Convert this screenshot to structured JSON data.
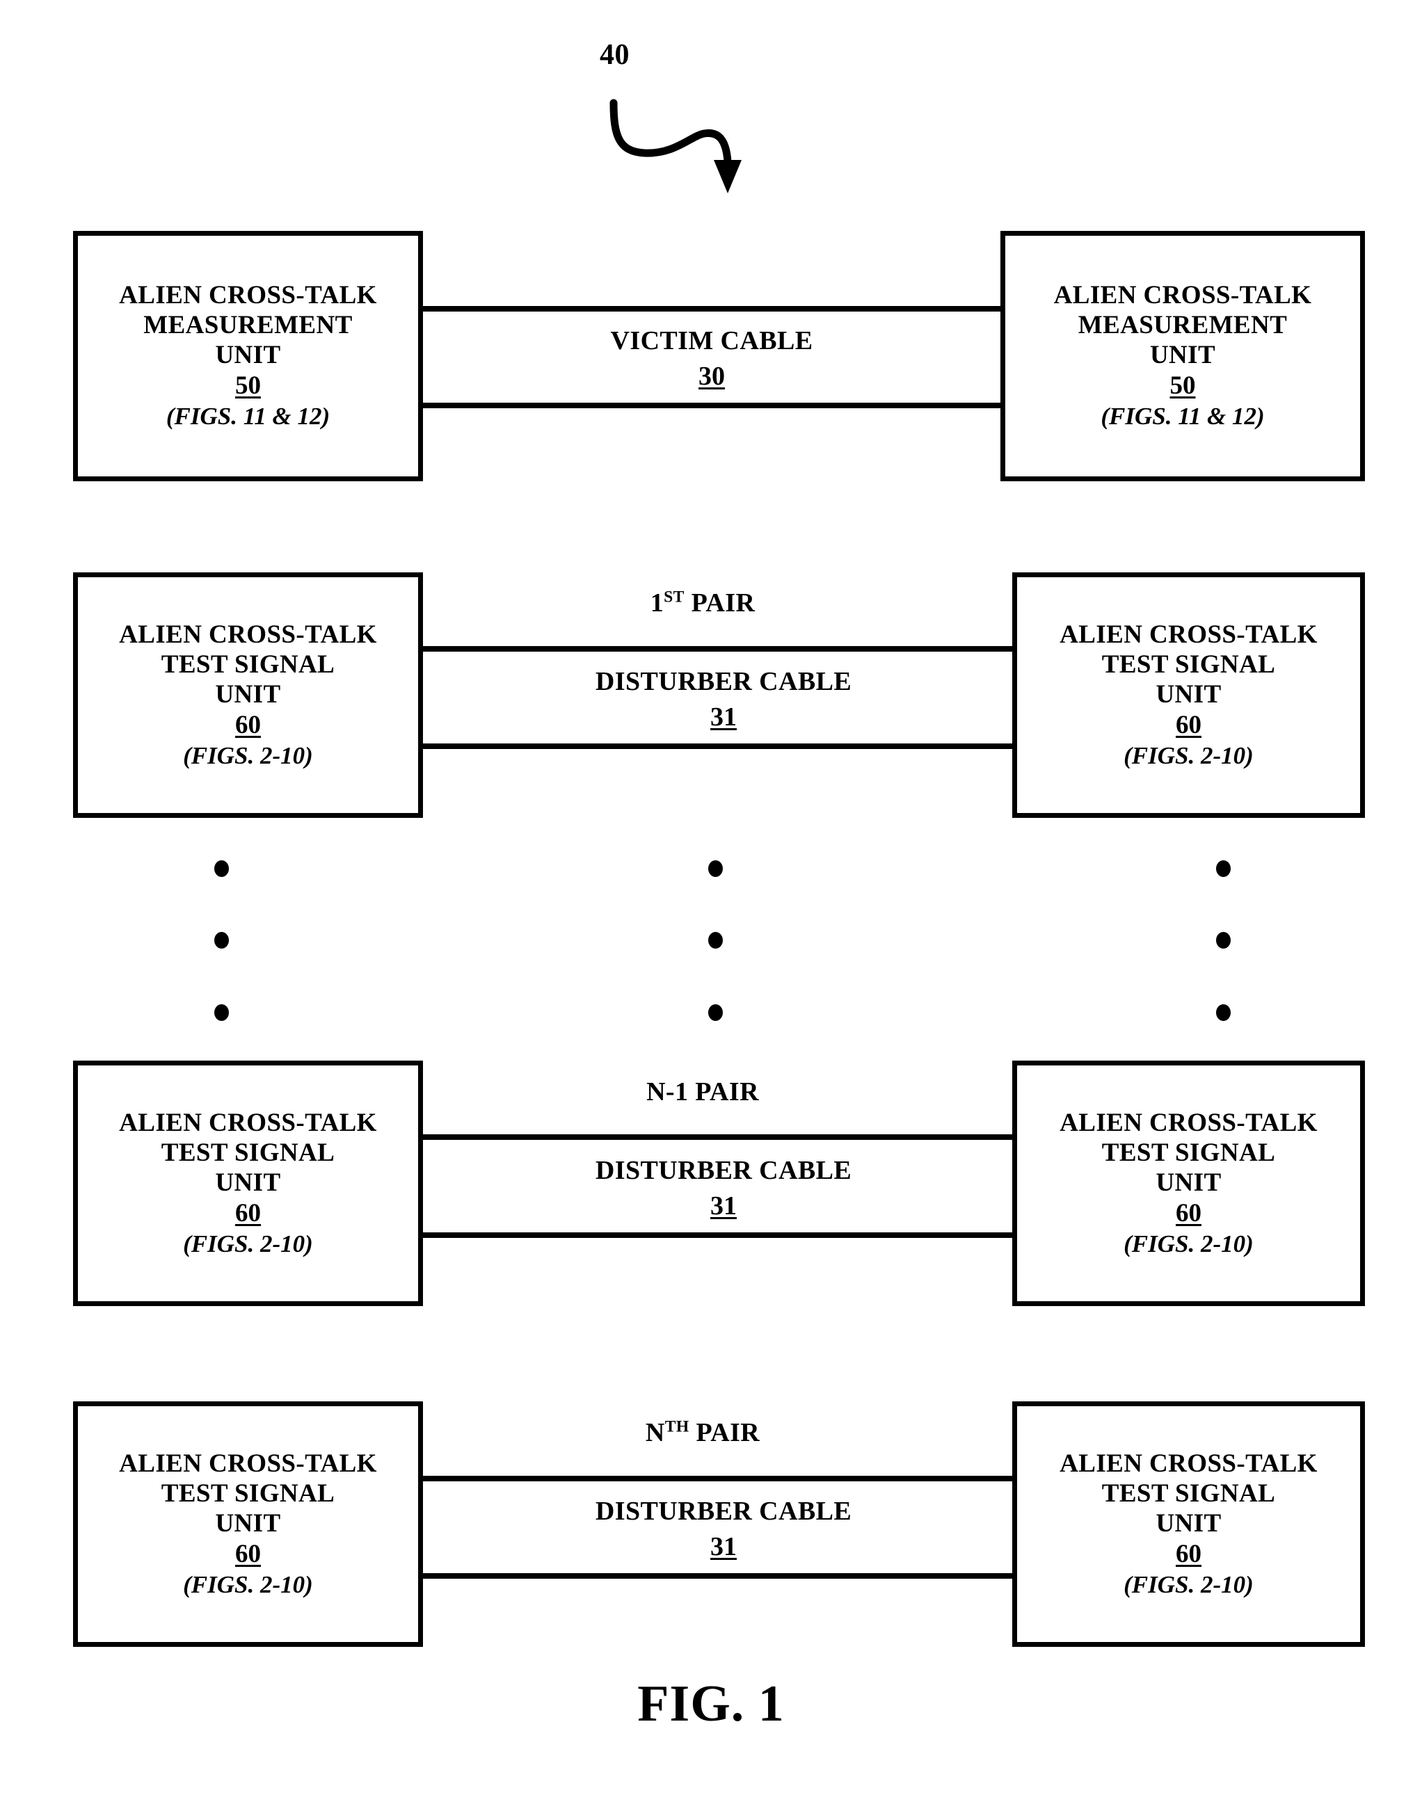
{
  "figure": {
    "reference_numeral": "40",
    "caption": "FIG. 1"
  },
  "rows": [
    {
      "id": "victim-row",
      "left_unit": {
        "line1": "ALIEN CROSS-TALK",
        "line2": "MEASUREMENT",
        "line3": "UNIT",
        "number": "50",
        "figs": "(FIGS. 11 & 12)"
      },
      "right_unit": {
        "line1": "ALIEN CROSS-TALK",
        "line2": "MEASUREMENT",
        "line3": "UNIT",
        "number": "50",
        "figs": "(FIGS. 11 & 12)"
      },
      "pair_label": "",
      "pair_sup": "",
      "cable_name": "VICTIM CABLE",
      "cable_number": "30"
    },
    {
      "id": "first-pair-row",
      "left_unit": {
        "line1": "ALIEN CROSS-TALK",
        "line2": "TEST SIGNAL",
        "line3": "UNIT",
        "number": "60",
        "figs": "(FIGS. 2-10)"
      },
      "right_unit": {
        "line1": "ALIEN CROSS-TALK",
        "line2": "TEST SIGNAL",
        "line3": "UNIT",
        "number": "60",
        "figs": "(FIGS. 2-10)"
      },
      "pair_label": "1",
      "pair_sup": "ST",
      "pair_suffix": " PAIR",
      "cable_name": "DISTURBER CABLE",
      "cable_number": "31"
    },
    {
      "id": "n-minus-1-pair-row",
      "left_unit": {
        "line1": "ALIEN CROSS-TALK",
        "line2": "TEST SIGNAL",
        "line3": "UNIT",
        "number": "60",
        "figs": "(FIGS. 2-10)"
      },
      "right_unit": {
        "line1": "ALIEN CROSS-TALK",
        "line2": "TEST SIGNAL",
        "line3": "UNIT",
        "number": "60",
        "figs": "(FIGS. 2-10)"
      },
      "pair_label": "N-1",
      "pair_sup": "",
      "pair_suffix": " PAIR",
      "cable_name": "DISTURBER CABLE",
      "cable_number": "31"
    },
    {
      "id": "nth-pair-row",
      "left_unit": {
        "line1": "ALIEN CROSS-TALK",
        "line2": "TEST SIGNAL",
        "line3": "UNIT",
        "number": "60",
        "figs": "(FIGS. 2-10)"
      },
      "right_unit": {
        "line1": "ALIEN CROSS-TALK",
        "line2": "TEST SIGNAL",
        "line3": "UNIT",
        "number": "60",
        "figs": "(FIGS. 2-10)"
      },
      "pair_label": "N",
      "pair_sup": "TH",
      "pair_suffix": " PAIR",
      "cable_name": "DISTURBER CABLE",
      "cable_number": "31"
    }
  ],
  "ellipsis": {
    "description": "vertical continuation dots",
    "count_per_column": 3,
    "columns": 3
  },
  "colors": {
    "ink": "#000000",
    "paper": "#ffffff"
  }
}
